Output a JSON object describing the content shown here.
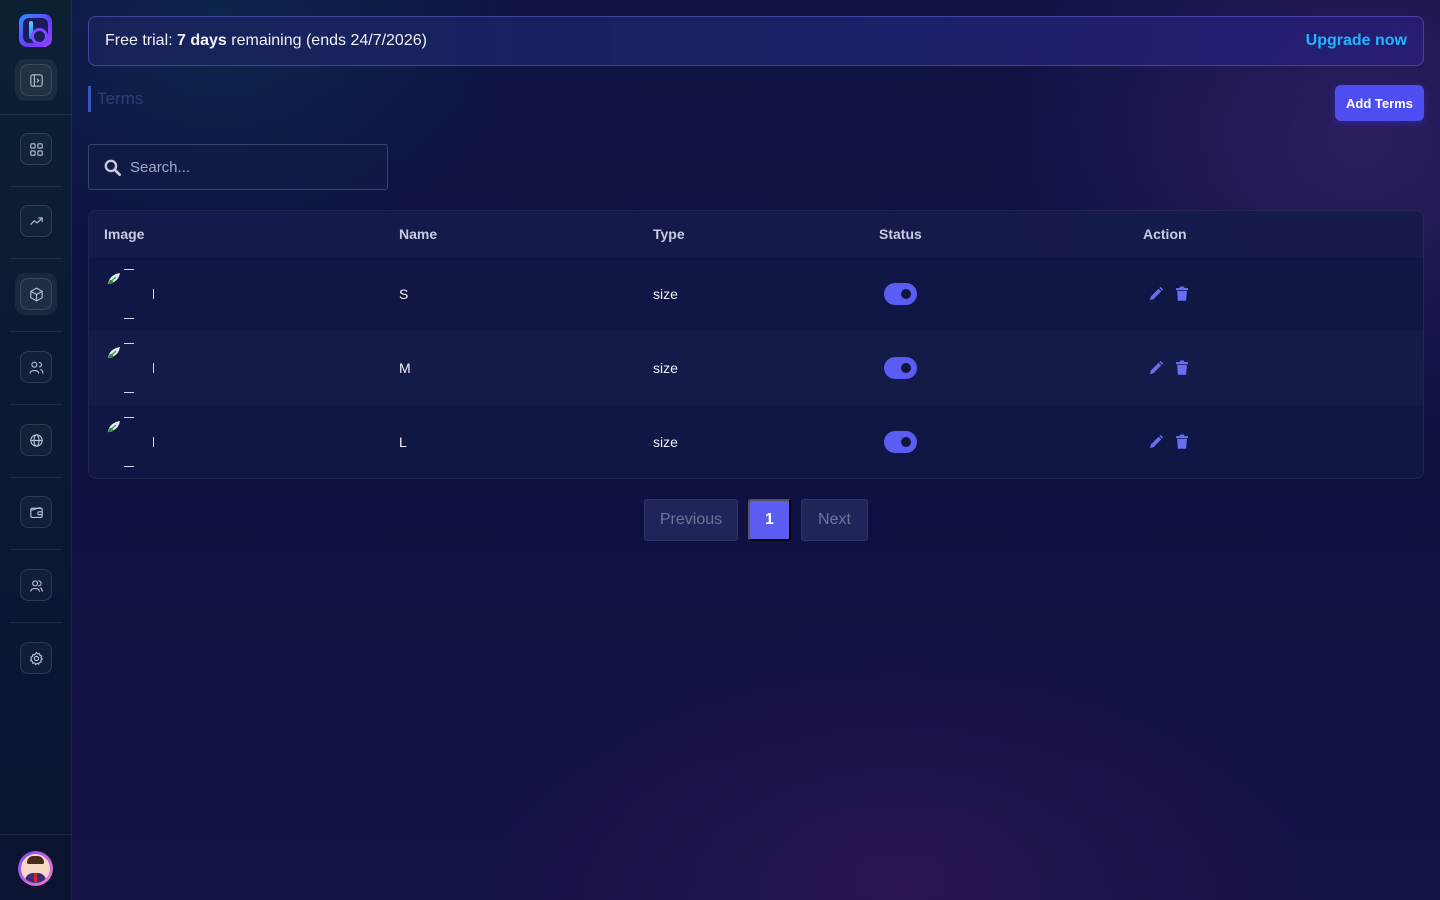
{
  "banner": {
    "prefix": "Free trial: ",
    "days": "7 days",
    "suffix": " remaining (ends 24/7/2026)",
    "upgrade_label": "Upgrade now"
  },
  "page": {
    "title": "Terms",
    "add_label": "Add Terms"
  },
  "search": {
    "placeholder": "Search..."
  },
  "table": {
    "headers": [
      "Image",
      "Name",
      "Type",
      "Status",
      "Action"
    ],
    "rows": [
      {
        "name": "S",
        "type": "size",
        "status": true
      },
      {
        "name": "M",
        "type": "size",
        "status": true
      },
      {
        "name": "L",
        "type": "size",
        "status": true
      }
    ]
  },
  "pagination": {
    "previous": "Previous",
    "current": "1",
    "next": "Next"
  },
  "sidebar": {
    "items": [
      "sidebar-toggle-icon",
      "dashboard-icon",
      "analytics-icon",
      "products-icon",
      "users-icon",
      "globe-icon",
      "wallet-icon",
      "team-icon",
      "settings-icon"
    ]
  },
  "colors": {
    "accent": "#5b5cf2",
    "link": "#1fb6ff",
    "background": "#0f1444"
  }
}
